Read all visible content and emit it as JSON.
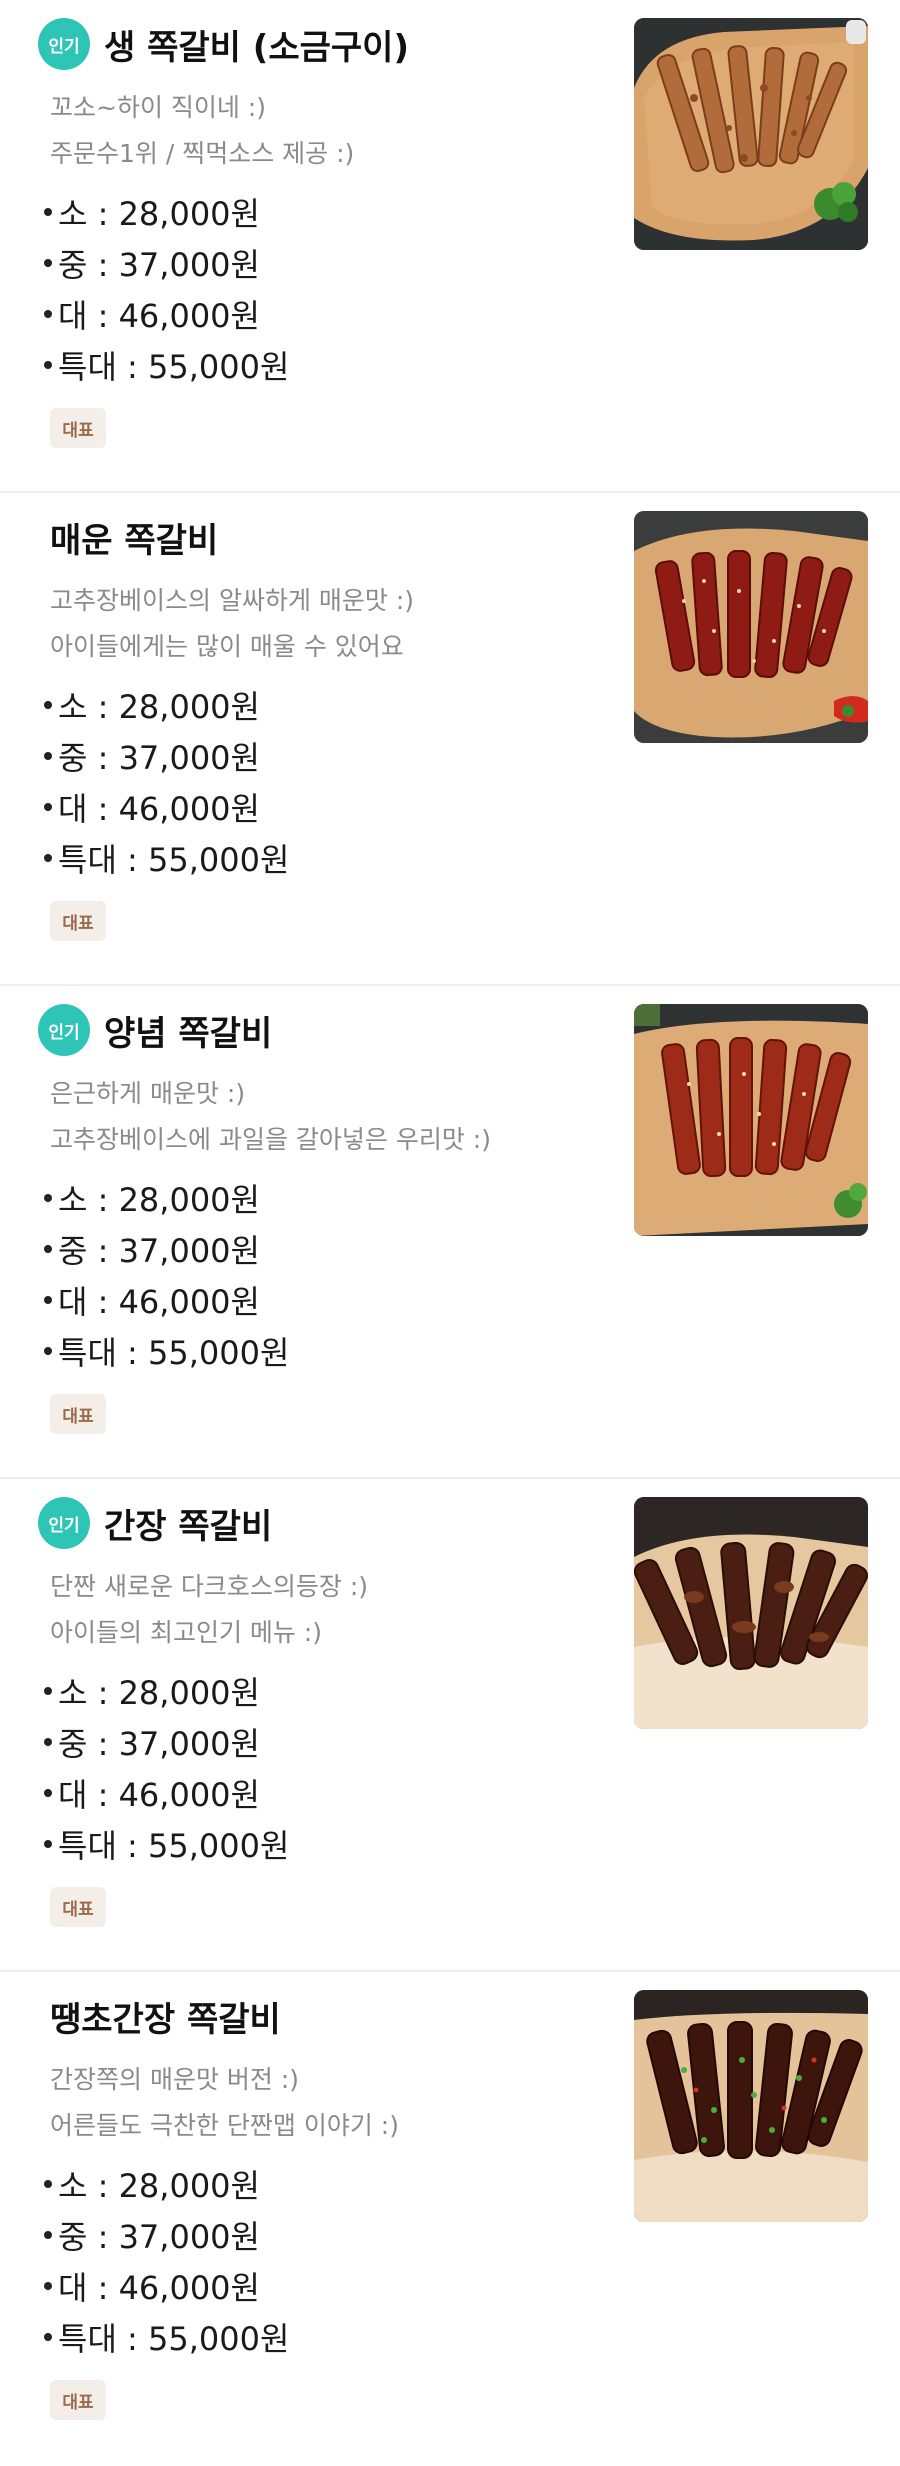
{
  "badges": {
    "popular": "인기",
    "representative": "대표"
  },
  "items": [
    {
      "popular": true,
      "title": "생 쪽갈비 (소금구이)",
      "desc1": "꼬소~하이 직이네 :)",
      "desc2": "주문수1위 / 찍먹소스 제공 :)",
      "prices": [
        "소 : 28,000원",
        "중 : 37,000원",
        "대 : 46,000원",
        "특대 : 55,000원"
      ],
      "photo": "salt-grilled-ribs-photo"
    },
    {
      "popular": false,
      "title": "매운 쪽갈비",
      "desc1": "고추장베이스의 알싸하게 매운맛 :)",
      "desc2": "아이들에게는 많이 매울 수 있어요",
      "prices": [
        "소 : 28,000원",
        "중 : 37,000원",
        "대 : 46,000원",
        "특대 : 55,000원"
      ],
      "photo": "spicy-ribs-photo"
    },
    {
      "popular": true,
      "title": "양념 쪽갈비",
      "desc1": "은근하게 매운맛 :)",
      "desc2": "고추장베이스에 과일을 갈아넣은 우리맛 :)",
      "prices": [
        "소 : 28,000원",
        "중 : 37,000원",
        "대 : 46,000원",
        "특대 : 55,000원"
      ],
      "photo": "seasoned-ribs-photo"
    },
    {
      "popular": true,
      "title": "간장 쪽갈비",
      "desc1": "단짠 새로운 다크호스의등장 :)",
      "desc2": "아이들의 최고인기 메뉴 :)",
      "prices": [
        "소 : 28,000원",
        "중 : 37,000원",
        "대 : 46,000원",
        "특대 : 55,000원"
      ],
      "photo": "soy-sauce-ribs-photo"
    },
    {
      "popular": false,
      "title": "땡초간장 쪽갈비",
      "desc1": "간장쪽의 매운맛 버전 :)",
      "desc2": "어른들도 극찬한 단짠맵 이야기 :)",
      "prices": [
        "소 : 28,000원",
        "중 : 37,000원",
        "대 : 46,000원",
        "특대 : 55,000원"
      ],
      "photo": "chili-soy-ribs-photo"
    }
  ],
  "colors": {
    "popular_badge": "#2ec4b6",
    "rep_tag_bg": "#f4eee8",
    "rep_tag_text": "#9a6a4a",
    "desc_text": "#8a8a8a"
  }
}
